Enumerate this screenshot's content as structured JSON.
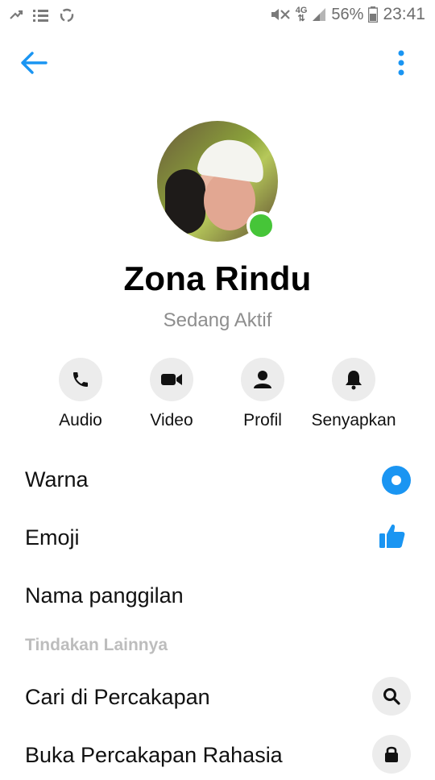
{
  "status_bar": {
    "battery_percent": "56%",
    "time": "23:41",
    "network": "4G",
    "icons": [
      "usb-icon",
      "notification-list-icon",
      "sync-icon",
      "mute-icon",
      "signal-icon",
      "battery-icon"
    ]
  },
  "header": {
    "back_icon": "arrow-left-icon",
    "more_icon": "more-vertical-icon",
    "accent_color": "#1a95f2"
  },
  "profile": {
    "name": "Zona Rindu",
    "status": "Sedang Aktif",
    "online_color": "#46c538"
  },
  "actions": [
    {
      "label": "Audio",
      "icon": "phone-icon"
    },
    {
      "label": "Video",
      "icon": "video-camera-icon"
    },
    {
      "label": "Profil",
      "icon": "person-icon"
    },
    {
      "label": "Senyapkan",
      "icon": "bell-icon"
    }
  ],
  "settings": {
    "warna": {
      "label": "Warna",
      "color": "#1a95f2"
    },
    "emoji": {
      "label": "Emoji",
      "icon": "thumbs-up-icon"
    },
    "nickname": {
      "label": "Nama panggilan"
    }
  },
  "more_actions": {
    "header": "Tindakan Lainnya",
    "items": [
      {
        "label": "Cari di Percakapan",
        "icon": "search-icon"
      },
      {
        "label": "Buka Percakapan Rahasia",
        "icon": "lock-icon"
      }
    ]
  }
}
